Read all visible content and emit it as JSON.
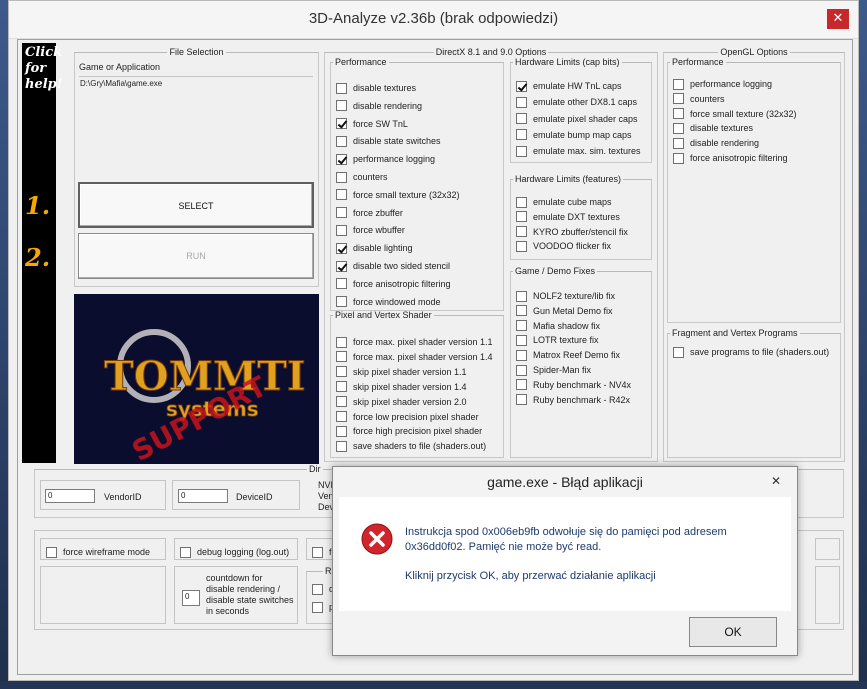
{
  "window": {
    "title": "3D-Analyze v2.36b (brak odpowiedzi)",
    "close_glyph": "✕"
  },
  "sidebar": {
    "help_lines": [
      "Click",
      "for",
      "help!"
    ],
    "step1": "1.",
    "step2": "2."
  },
  "file_selection": {
    "legend": "File Selection",
    "label": "Game or Application",
    "path": "D:\\Gry\\Mafia\\game.exe",
    "select_label": "SELECT",
    "run_label": "RUN"
  },
  "logo": {
    "main_text": "TOMMTI",
    "sub_text": "systems",
    "stamp_text": "SUPPORT",
    "colors": {
      "gold": "#e0a020",
      "red": "#c8121c",
      "bg": "#0b0d2e"
    }
  },
  "directx": {
    "legend": "DirectX 8.1 and 9.0 Options",
    "performance": {
      "legend": "Performance",
      "items": [
        {
          "label": "disable textures",
          "checked": false
        },
        {
          "label": "disable rendering",
          "checked": false
        },
        {
          "label": "force SW TnL",
          "checked": true
        },
        {
          "label": "disable state switches",
          "checked": false
        },
        {
          "label": "performance logging",
          "checked": true
        },
        {
          "label": "counters",
          "checked": false
        },
        {
          "label": "force small texture (32x32)",
          "checked": false
        },
        {
          "label": "force zbuffer",
          "checked": false
        },
        {
          "label": "force wbuffer",
          "checked": false
        },
        {
          "label": "disable lighting",
          "checked": true
        },
        {
          "label": "disable two sided stencil",
          "checked": true
        },
        {
          "label": "force anisotropic filtering",
          "checked": false
        },
        {
          "label": "force windowed mode",
          "checked": false
        }
      ]
    },
    "shader": {
      "legend": "Pixel and Vertex Shader",
      "items": [
        {
          "label": "force max. pixel shader version 1.1",
          "checked": false
        },
        {
          "label": "force max. pixel shader version 1.4",
          "checked": false
        },
        {
          "label": "skip pixel shader version 1.1",
          "checked": false
        },
        {
          "label": "skip pixel shader version 1.4",
          "checked": false
        },
        {
          "label": "skip pixel shader version 2.0",
          "checked": false
        },
        {
          "label": "force low precision pixel shader",
          "checked": false
        },
        {
          "label": "force high precision pixel shader",
          "checked": false
        },
        {
          "label": "save shaders to file (shaders.out)",
          "checked": false
        }
      ]
    },
    "caps": {
      "legend": "Hardware Limits (cap bits)",
      "items": [
        {
          "label": "emulate HW TnL caps",
          "checked": true
        },
        {
          "label": "emulate other DX8.1 caps",
          "checked": false
        },
        {
          "label": "emulate pixel shader caps",
          "checked": false
        },
        {
          "label": "emulate bump map caps",
          "checked": false
        },
        {
          "label": "emulate max. sim. textures",
          "checked": false
        }
      ]
    },
    "features": {
      "legend": "Hardware Limits (features)",
      "items": [
        {
          "label": "emulate cube maps",
          "checked": false
        },
        {
          "label": "emulate DXT textures",
          "checked": false
        },
        {
          "label": "KYRO zbuffer/stencil fix",
          "checked": false
        },
        {
          "label": "VOODOO flicker fix",
          "checked": false
        }
      ]
    },
    "fixes": {
      "legend": "Game / Demo Fixes",
      "items": [
        {
          "label": "NOLF2 texture/lib fix",
          "checked": false
        },
        {
          "label": "Gun Metal Demo fix",
          "checked": false
        },
        {
          "label": "Mafia shadow fix",
          "checked": false
        },
        {
          "label": "LOTR texture fix",
          "checked": false
        },
        {
          "label": "Matrox Reef Demo fix",
          "checked": false
        },
        {
          "label": "Spider-Man fix",
          "checked": false
        },
        {
          "label": "Ruby benchmark - NV4x",
          "checked": false
        },
        {
          "label": "Ruby benchmark - R42x",
          "checked": false
        }
      ]
    }
  },
  "opengl": {
    "legend": "OpenGL Options",
    "performance": {
      "legend": "Performance",
      "items": [
        {
          "label": "performance logging",
          "checked": false
        },
        {
          "label": "counters",
          "checked": false
        },
        {
          "label": "force small texture (32x32)",
          "checked": false
        },
        {
          "label": "disable textures",
          "checked": false
        },
        {
          "label": "disable rendering",
          "checked": false
        },
        {
          "label": "force anisotropic filtering",
          "checked": false
        }
      ]
    },
    "fragment": {
      "legend": "Fragment and Vertex Programs",
      "items": [
        {
          "label": "save programs to file (shaders.out)",
          "checked": false
        }
      ]
    }
  },
  "ids": {
    "legend_partial": "Dir",
    "vendor_value": "0",
    "vendor_label": "VendorID",
    "device_value": "0",
    "device_label": "DeviceID",
    "partial_lines": [
      "NVIDI",
      "Vendo",
      "Devic"
    ]
  },
  "bottom": {
    "wireframe_label": "force wireframe mode",
    "debug_label": "debug logging (log.out)",
    "partial_for": "for",
    "countdown_value": "0",
    "countdown_lines": [
      "countdown for",
      "disable rendering /",
      "disable state switches",
      "in seconds"
    ],
    "partial_r": "R",
    "partial_qua": "qua",
    "partial_per": "per"
  },
  "dialog": {
    "title": "game.exe - Błąd aplikacji",
    "close_glyph": "✕",
    "message_line1": "Instrukcja spod 0x006eb9fb odwołuje się do pamięci pod adresem",
    "message_line2": "0x36dd0f02. Pamięć nie może być read.",
    "message_line3": "Kliknij przycisk OK, aby przerwać działanie aplikacji",
    "ok_label": "OK",
    "icon": "error-icon"
  }
}
